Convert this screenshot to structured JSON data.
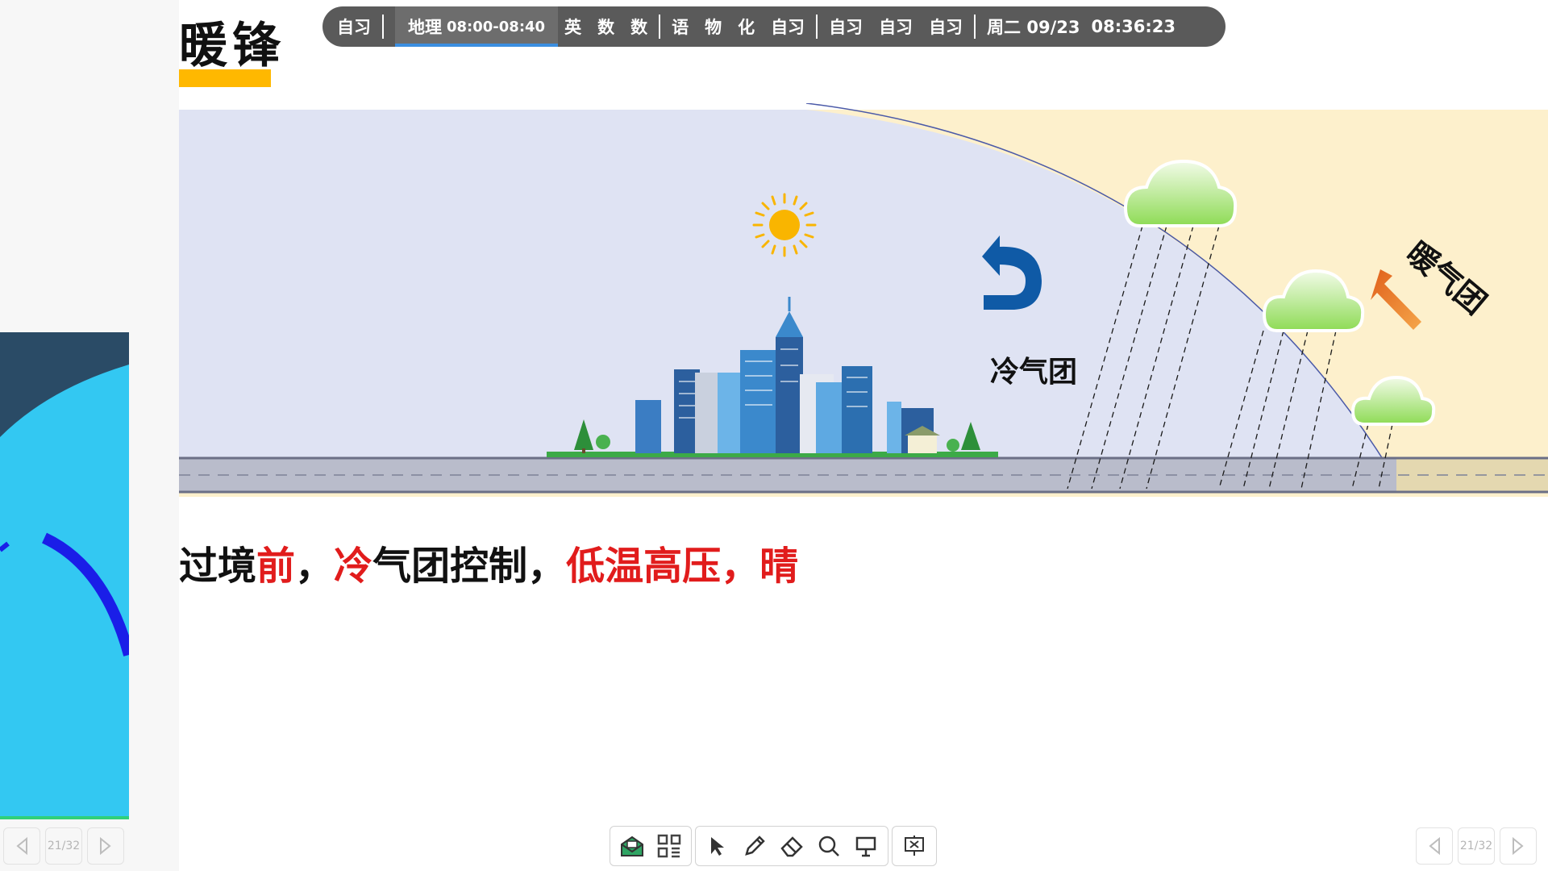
{
  "slide": {
    "title": "暖锋",
    "caption": [
      {
        "text": "过境",
        "highlight": false
      },
      {
        "text": "前",
        "highlight": true
      },
      {
        "text": "，",
        "highlight": false
      },
      {
        "text": "冷",
        "highlight": true
      },
      {
        "text": "气团控制，",
        "highlight": false
      },
      {
        "text": "低温高压，晴",
        "highlight": true
      }
    ],
    "diagram": {
      "cold_air_label": "冷气团",
      "warm_air_label": "暖气团"
    }
  },
  "schedule": {
    "items_1": [
      "自习"
    ],
    "current": {
      "subject": "地理",
      "time": "08:00-08:40"
    },
    "items_2": [
      "英",
      "数",
      "数"
    ],
    "items_3": [
      "语",
      "物",
      "化",
      "自习"
    ],
    "items_4": [
      "自习",
      "自习",
      "自习"
    ],
    "day": "周二 09/23",
    "clock": "08:36:23"
  },
  "pager": {
    "left": {
      "page": "21/32"
    },
    "right": {
      "page": "21/32"
    }
  },
  "toolbar": {
    "icons": [
      "envelope-icon",
      "qr-code-icon",
      "cursor-icon",
      "pen-icon",
      "eraser-icon",
      "search-icon",
      "presentation-icon",
      "exit-show-icon"
    ]
  },
  "colors": {
    "cold_region": "#dfe3f3",
    "warm_region": "#fdf0cc",
    "title_underline": "#ffb800",
    "highlight_text": "#e11c1c",
    "schedule_bg": "#5a5a5a",
    "arrow_cold": "#0f5aa6",
    "arrow_warm": "#ee8a2a",
    "thumbnail_bg": "#33c8f2"
  }
}
